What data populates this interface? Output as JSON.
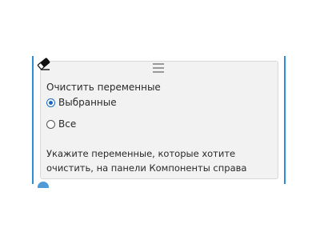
{
  "panel": {
    "icon": "eraser-icon",
    "handle_icon": "drag-handle-icon",
    "title": "Очистить переменные",
    "options": [
      {
        "label": "Выбранные",
        "selected": true
      },
      {
        "label": "Все",
        "selected": false
      }
    ],
    "hint_line1": "Укажите переменные, которые хотите",
    "hint_line2": "очистить, на панели Компоненты справа"
  },
  "colors": {
    "accent": "#2b8ed6",
    "radio_selected": "#1766c4",
    "panel_background": "#f2f2f2"
  }
}
